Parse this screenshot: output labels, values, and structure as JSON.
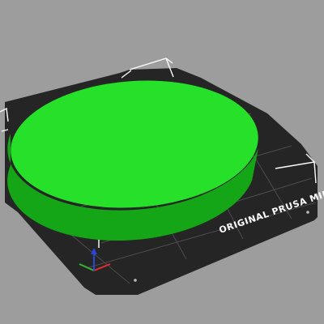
{
  "viewport": {
    "background_color": "#9d9d9d"
  },
  "bed": {
    "label": "ORIGINAL PRUSA MINI",
    "color": "#252525",
    "grid_color": "#4d4d4d",
    "corner_mark_color": "#ffffff",
    "label_color": "#ffffff"
  },
  "model": {
    "shape": "cylinder",
    "top_color": "#27e02a",
    "side_color": "#14a617"
  },
  "axes": {
    "x_color": "#e03030",
    "y_color": "#33b833",
    "z_color": "#2b45d6"
  }
}
